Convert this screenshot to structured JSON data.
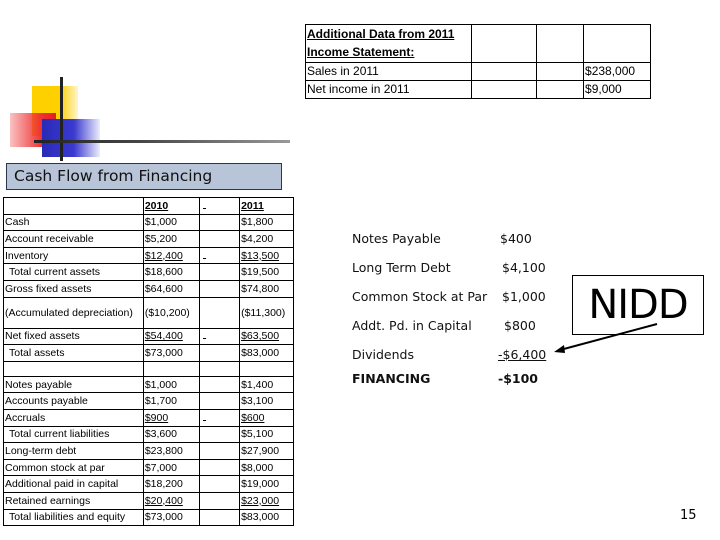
{
  "additional_data": {
    "header_line1": "Additional Data from 2011",
    "header_line2": "Income Statement:",
    "rows": [
      {
        "label": "Sales in 2011",
        "value": "$238,000"
      },
      {
        "label": "Net income in 2011",
        "value": "$9,000"
      }
    ]
  },
  "section_title": "Cash Flow from Financing",
  "balance_sheet": {
    "headers": {
      "y2010": "2010",
      "y2011": "2011"
    },
    "rows": [
      {
        "label": "Cash",
        "y2010": "$1,000",
        "y2011": "$1,800"
      },
      {
        "label": "Account receivable",
        "y2010": "$5,200",
        "y2011": "$4,200"
      },
      {
        "label": "Inventory",
        "y2010": "$12,400",
        "y2011": "$13,500"
      },
      {
        "label": "Total current assets",
        "y2010": "$18,600",
        "y2011": "$19,500"
      },
      {
        "label": "Gross fixed assets",
        "y2010": "$64,600",
        "y2011": "$74,800"
      },
      {
        "label": "(Accumulated depreciation)",
        "y2010": "($10,200)",
        "y2011": "($11,300)"
      },
      {
        "label": "Net fixed assets",
        "y2010": "$54,400",
        "y2011": "$63,500"
      },
      {
        "label": "Total assets",
        "y2010": "$73,000",
        "y2011": "$83,000"
      },
      {
        "label": "",
        "y2010": "",
        "y2011": ""
      },
      {
        "label": "Notes payable",
        "y2010": "$1,000",
        "y2011": "$1,400"
      },
      {
        "label": "Accounts payable",
        "y2010": "$1,700",
        "y2011": "$3,100"
      },
      {
        "label": "Accruals",
        "y2010": "$900",
        "y2011": "$600"
      },
      {
        "label": "Total current liabilities",
        "y2010": "$3,600",
        "y2011": "$5,100"
      },
      {
        "label": "Long-term debt",
        "y2010": "$23,800",
        "y2011": "$27,900"
      },
      {
        "label": "Common stock at par",
        "y2010": "$7,000",
        "y2011": "$8,000"
      },
      {
        "label": "Additional paid in capital",
        "y2010": "$18,200",
        "y2011": "$19,000"
      },
      {
        "label": "Retained earnings",
        "y2010": "$20,400",
        "y2011": "$23,000"
      },
      {
        "label": "Total liabilities and equity",
        "y2010": "$73,000",
        "y2011": "$83,000"
      }
    ]
  },
  "financing": {
    "items": [
      {
        "label": "Notes Payable",
        "value": "$400"
      },
      {
        "label": "Long Term Debt",
        "value": "$4,100"
      },
      {
        "label": "Common Stock at Par",
        "value": "$1,000"
      },
      {
        "label": "Addt. Pd. in Capital",
        "value": "$800"
      },
      {
        "label": "Dividends",
        "value": "-$6,400"
      },
      {
        "label": "FINANCING",
        "value": "-$100"
      }
    ]
  },
  "callout": "NIDD",
  "page_number": "15"
}
